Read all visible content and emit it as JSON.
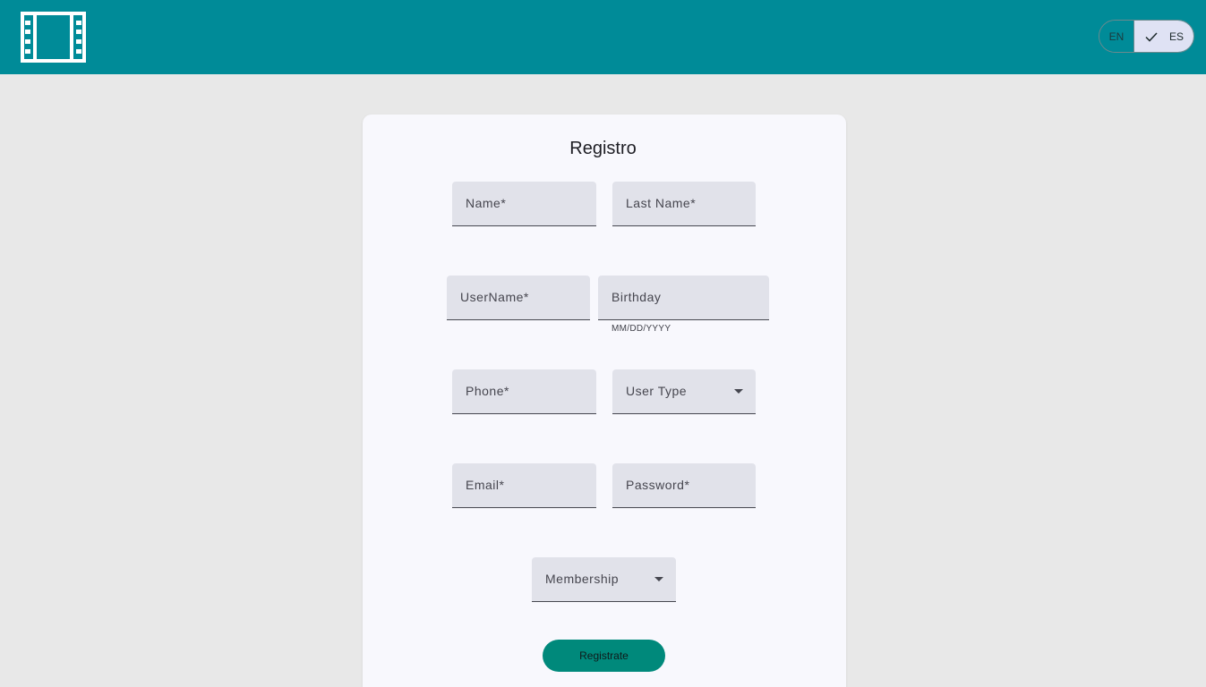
{
  "header": {
    "logo_icon": "film-strip-icon",
    "background_color": "#008b98",
    "language_toggle": {
      "options": [
        "EN",
        "ES"
      ],
      "selected": "ES",
      "selected_icon": "check-icon"
    }
  },
  "form": {
    "title": "Registro",
    "fields": {
      "name": "Name*",
      "last_name": "Last Name*",
      "username": "UserName*",
      "birthday": "Birthday",
      "birthday_hint": "MM/DD/YYYY",
      "phone": "Phone*",
      "user_type": "User Type",
      "email": "Email*",
      "password": "Password*",
      "membership": "Membership"
    },
    "submit_label": "Registrate",
    "submit_color": "#00897b"
  }
}
